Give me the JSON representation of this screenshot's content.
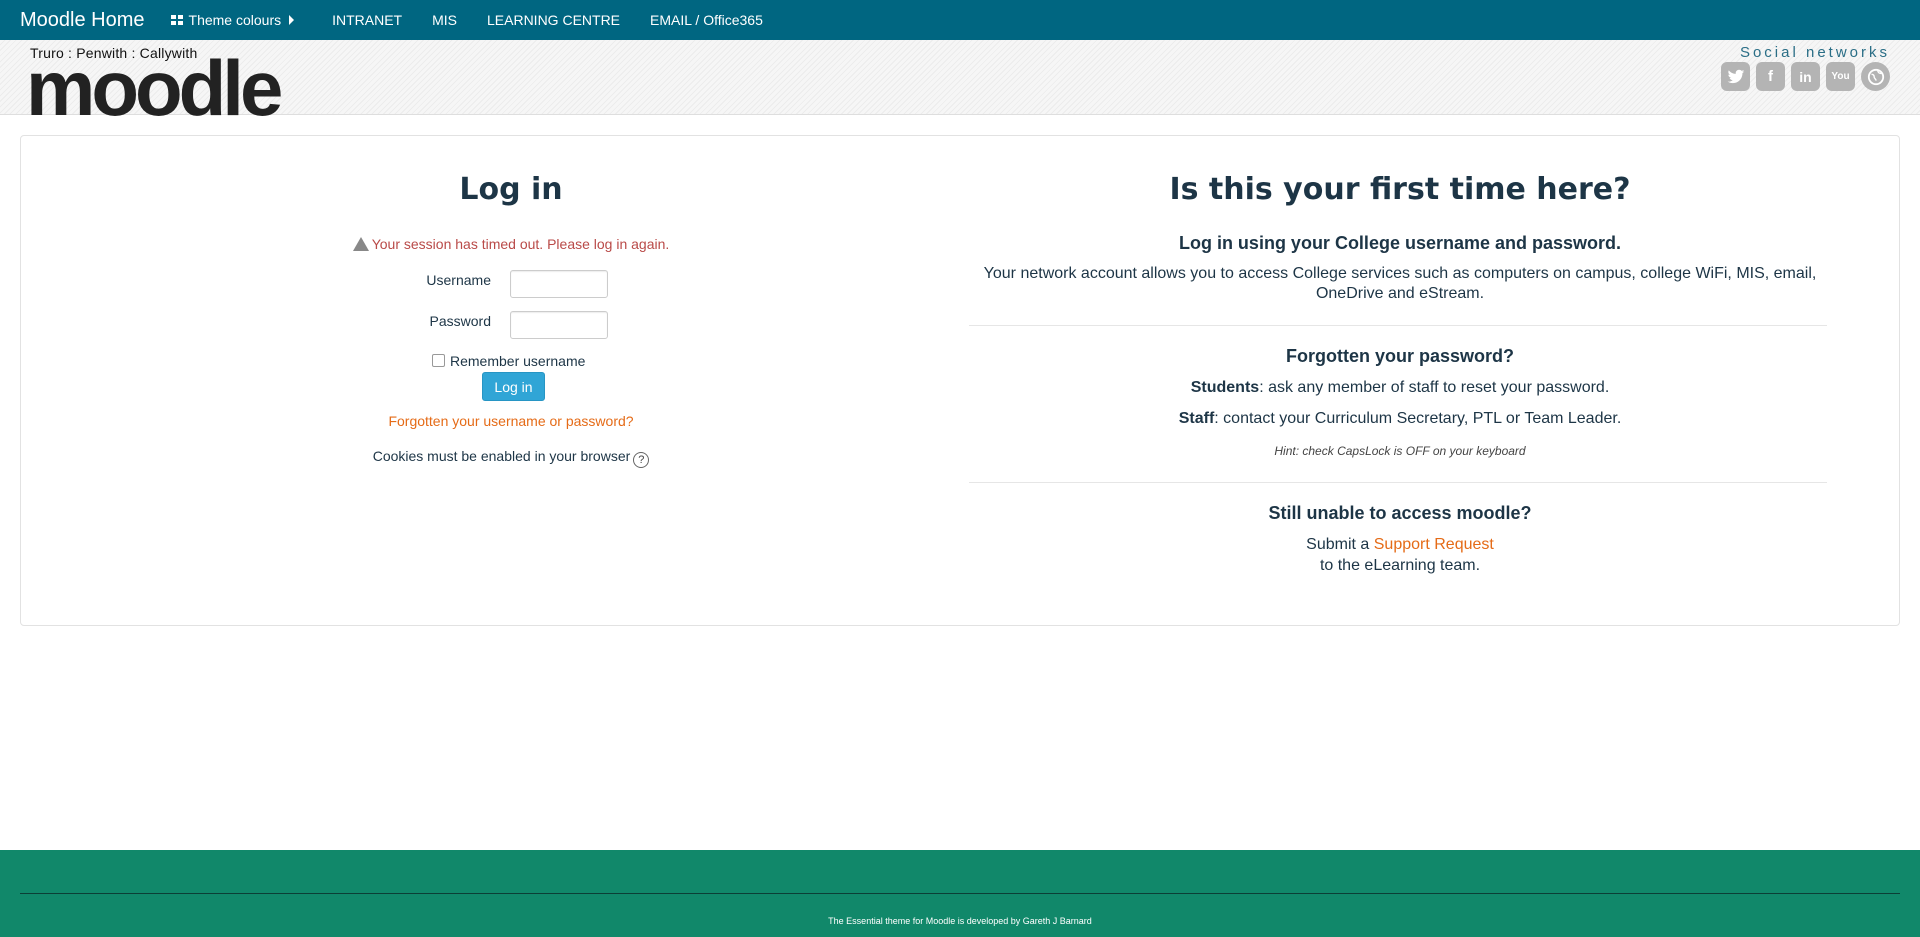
{
  "navbar": {
    "brand": "Moodle Home",
    "theme_colours": "Theme colours",
    "links": [
      "INTRANET",
      "MIS",
      "LEARNING CENTRE",
      "EMAIL / Office365"
    ]
  },
  "header": {
    "logo_subtitle": "Truro : Penwith : Callywith",
    "logo_text": "moodle",
    "social_title": "Social networks",
    "social_icons": [
      "twitter-icon",
      "facebook-icon",
      "linkedin-icon",
      "youtube-icon",
      "website-icon"
    ]
  },
  "login": {
    "title": "Log in",
    "timeout_message": "Your session has timed out. Please log in again.",
    "username_label": "Username",
    "username_value": "",
    "password_label": "Password",
    "password_value": "",
    "remember_label": "Remember username",
    "remember_checked": false,
    "login_button": "Log in",
    "forgot_link": "Forgotten your username or password?",
    "cookies_text": "Cookies must be enabled in your browser"
  },
  "firsttime": {
    "title": "Is this your first time here?",
    "h1": "Log in using your College username and password.",
    "p1": "Your network account allows you to access College services such as computers on campus, college WiFi, MIS, email, OneDrive and eStream.",
    "h2": "Forgotten your password?",
    "students_label": "Students",
    "students_text": ": ask any member of staff to reset your password.",
    "staff_label": "Staff",
    "staff_text": ": contact your Curriculum Secretary, PTL or Team Leader.",
    "hint": "Hint: check CapsLock is OFF on your keyboard",
    "h3": "Still unable to access moodle?",
    "submit_prefix": "Submit a ",
    "support_link": "Support Request",
    "submit_suffix": "to the eLearning team."
  },
  "footer": {
    "credit": "The Essential theme for Moodle is developed by Gareth J Barnard"
  },
  "colors": {
    "navbar": "#006681",
    "footer": "#11886a",
    "link": "#e56b17",
    "button": "#30a5d6",
    "error": "#b94a48"
  }
}
